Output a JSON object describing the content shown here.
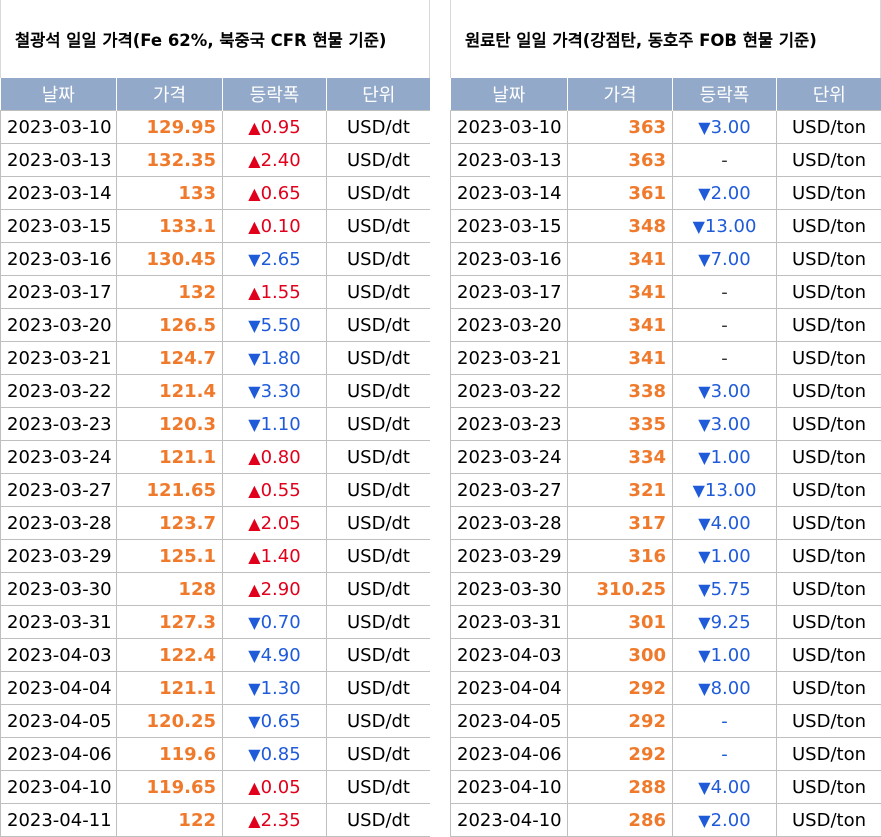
{
  "left": {
    "title": "철광석 일일 가격(Fe 62%, 북중국 CFR 현물 기준)",
    "headers": [
      "날짜",
      "가격",
      "등락폭",
      "단위"
    ],
    "rows": [
      {
        "date": "2023-03-10",
        "price": "129.95",
        "change": "0.95",
        "dir": "up",
        "unit": "USD/dt"
      },
      {
        "date": "2023-03-13",
        "price": "132.35",
        "change": "2.40",
        "dir": "up",
        "unit": "USD/dt"
      },
      {
        "date": "2023-03-14",
        "price": "133",
        "change": "0.65",
        "dir": "up",
        "unit": "USD/dt"
      },
      {
        "date": "2023-03-15",
        "price": "133.1",
        "change": "0.10",
        "dir": "up",
        "unit": "USD/dt"
      },
      {
        "date": "2023-03-16",
        "price": "130.45",
        "change": "2.65",
        "dir": "down",
        "unit": "USD/dt"
      },
      {
        "date": "2023-03-17",
        "price": "132",
        "change": "1.55",
        "dir": "up",
        "unit": "USD/dt"
      },
      {
        "date": "2023-03-20",
        "price": "126.5",
        "change": "5.50",
        "dir": "down",
        "unit": "USD/dt"
      },
      {
        "date": "2023-03-21",
        "price": "124.7",
        "change": "1.80",
        "dir": "down",
        "unit": "USD/dt"
      },
      {
        "date": "2023-03-22",
        "price": "121.4",
        "change": "3.30",
        "dir": "down",
        "unit": "USD/dt"
      },
      {
        "date": "2023-03-23",
        "price": "120.3",
        "change": "1.10",
        "dir": "down",
        "unit": "USD/dt"
      },
      {
        "date": "2023-03-24",
        "price": "121.1",
        "change": "0.80",
        "dir": "up",
        "unit": "USD/dt"
      },
      {
        "date": "2023-03-27",
        "price": "121.65",
        "change": "0.55",
        "dir": "up",
        "unit": "USD/dt"
      },
      {
        "date": "2023-03-28",
        "price": "123.7",
        "change": "2.05",
        "dir": "up",
        "unit": "USD/dt"
      },
      {
        "date": "2023-03-29",
        "price": "125.1",
        "change": "1.40",
        "dir": "up",
        "unit": "USD/dt"
      },
      {
        "date": "2023-03-30",
        "price": "128",
        "change": "2.90",
        "dir": "up",
        "unit": "USD/dt"
      },
      {
        "date": "2023-03-31",
        "price": "127.3",
        "change": "0.70",
        "dir": "down",
        "unit": "USD/dt"
      },
      {
        "date": "2023-04-03",
        "price": "122.4",
        "change": "4.90",
        "dir": "down",
        "unit": "USD/dt"
      },
      {
        "date": "2023-04-04",
        "price": "121.1",
        "change": "1.30",
        "dir": "down",
        "unit": "USD/dt"
      },
      {
        "date": "2023-04-05",
        "price": "120.25",
        "change": "0.65",
        "dir": "down",
        "unit": "USD/dt"
      },
      {
        "date": "2023-04-06",
        "price": "119.6",
        "change": "0.85",
        "dir": "down",
        "unit": "USD/dt"
      },
      {
        "date": "2023-04-10",
        "price": "119.65",
        "change": "0.05",
        "dir": "up",
        "unit": "USD/dt"
      },
      {
        "date": "2023-04-11",
        "price": "122",
        "change": "2.35",
        "dir": "up",
        "unit": "USD/dt"
      }
    ]
  },
  "right": {
    "title": "원료탄 일일 가격(강점탄, 동호주 FOB 현물 기준)",
    "headers": [
      "날짜",
      "가격",
      "등락폭",
      "단위"
    ],
    "rows": [
      {
        "date": "2023-03-10",
        "price": "363",
        "change": "3.00",
        "dir": "down",
        "unit": "USD/ton"
      },
      {
        "date": "2023-03-13",
        "price": "363",
        "change": "-",
        "dir": "none",
        "unit": "USD/ton"
      },
      {
        "date": "2023-03-14",
        "price": "361",
        "change": "2.00",
        "dir": "down",
        "unit": "USD/ton"
      },
      {
        "date": "2023-03-15",
        "price": "348",
        "change": "13.00",
        "dir": "down",
        "unit": "USD/ton"
      },
      {
        "date": "2023-03-16",
        "price": "341",
        "change": "7.00",
        "dir": "down",
        "unit": "USD/ton"
      },
      {
        "date": "2023-03-17",
        "price": "341",
        "change": "-",
        "dir": "none",
        "unit": "USD/ton"
      },
      {
        "date": "2023-03-20",
        "price": "341",
        "change": "-",
        "dir": "none",
        "unit": "USD/ton"
      },
      {
        "date": "2023-03-21",
        "price": "341",
        "change": "-",
        "dir": "none",
        "unit": "USD/ton"
      },
      {
        "date": "2023-03-22",
        "price": "338",
        "change": "3.00",
        "dir": "down",
        "unit": "USD/ton"
      },
      {
        "date": "2023-03-23",
        "price": "335",
        "change": "3.00",
        "dir": "down",
        "unit": "USD/ton"
      },
      {
        "date": "2023-03-24",
        "price": "334",
        "change": "1.00",
        "dir": "down",
        "unit": "USD/ton"
      },
      {
        "date": "2023-03-27",
        "price": "321",
        "change": "13.00",
        "dir": "down",
        "unit": "USD/ton"
      },
      {
        "date": "2023-03-28",
        "price": "317",
        "change": "4.00",
        "dir": "down",
        "unit": "USD/ton"
      },
      {
        "date": "2023-03-29",
        "price": "316",
        "change": "1.00",
        "dir": "down",
        "unit": "USD/ton"
      },
      {
        "date": "2023-03-30",
        "price": "310.25",
        "change": "5.75",
        "dir": "down",
        "unit": "USD/ton"
      },
      {
        "date": "2023-03-31",
        "price": "301",
        "change": "9.25",
        "dir": "down",
        "unit": "USD/ton"
      },
      {
        "date": "2023-04-03",
        "price": "300",
        "change": "1.00",
        "dir": "down",
        "unit": "USD/ton"
      },
      {
        "date": "2023-04-04",
        "price": "292",
        "change": "8.00",
        "dir": "down",
        "unit": "USD/ton"
      },
      {
        "date": "2023-04-05",
        "price": "292",
        "change": "-",
        "dir": "none-blue",
        "unit": "USD/ton"
      },
      {
        "date": "2023-04-06",
        "price": "292",
        "change": "-",
        "dir": "none-blue",
        "unit": "USD/ton"
      },
      {
        "date": "2023-04-10",
        "price": "288",
        "change": "4.00",
        "dir": "down",
        "unit": "USD/ton"
      },
      {
        "date": "2023-04-10",
        "price": "286",
        "change": "2.00",
        "dir": "down",
        "unit": "USD/ton"
      }
    ]
  },
  "colors": {
    "header_bg": "#92a9c9",
    "price": "#f07a2c",
    "up": "#e0001b",
    "down": "#1f5bd9"
  },
  "icons": {
    "up": "▲",
    "down": "▼"
  }
}
